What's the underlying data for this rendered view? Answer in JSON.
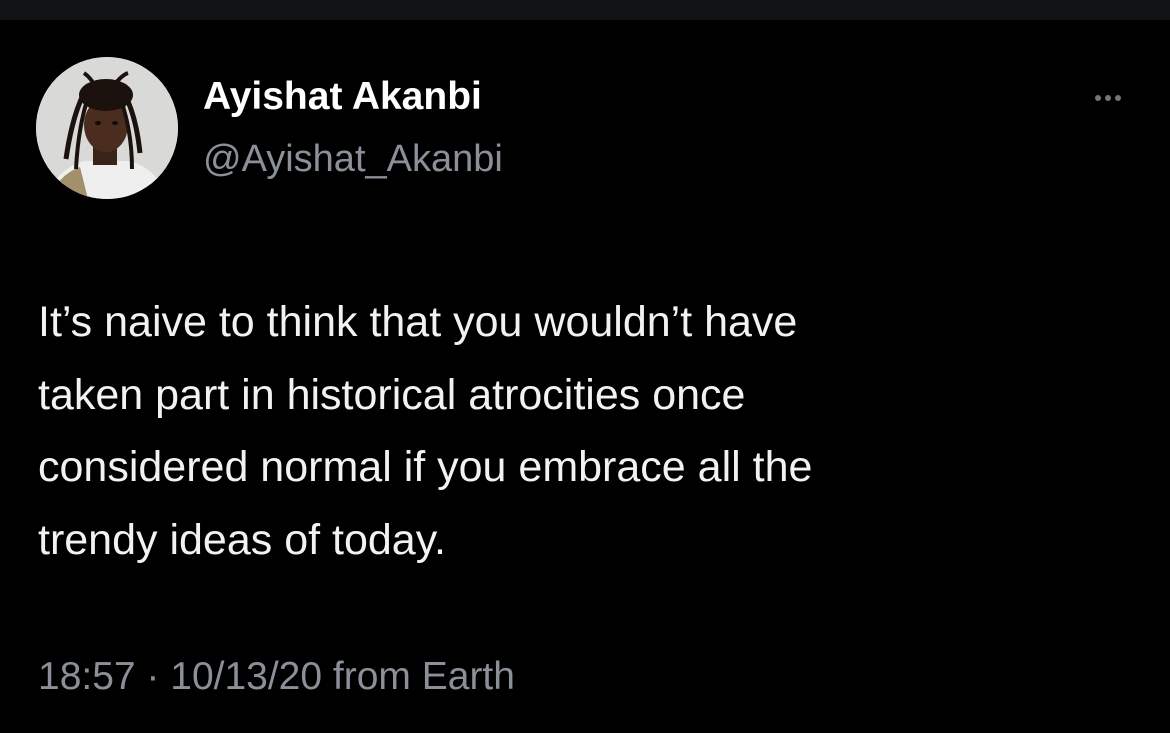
{
  "tweet": {
    "author": {
      "display_name": "Ayishat Akanbi",
      "handle": "@Ayishat_Akanbi",
      "avatar_icon": "profile-photo"
    },
    "more_icon": "more-horizontal-icon",
    "text": "It’s naive to think that you wouldn’t have\ntaken part in historical atrocities once\nconsidered normal if you embrace all the\ntrendy ideas of today.",
    "timestamp": "18:57 · 10/13/20 from Earth"
  },
  "colors": {
    "background": "#000000",
    "text_primary": "#f2f2f2",
    "text_secondary": "#8b9098",
    "icon_muted": "#71767b"
  }
}
